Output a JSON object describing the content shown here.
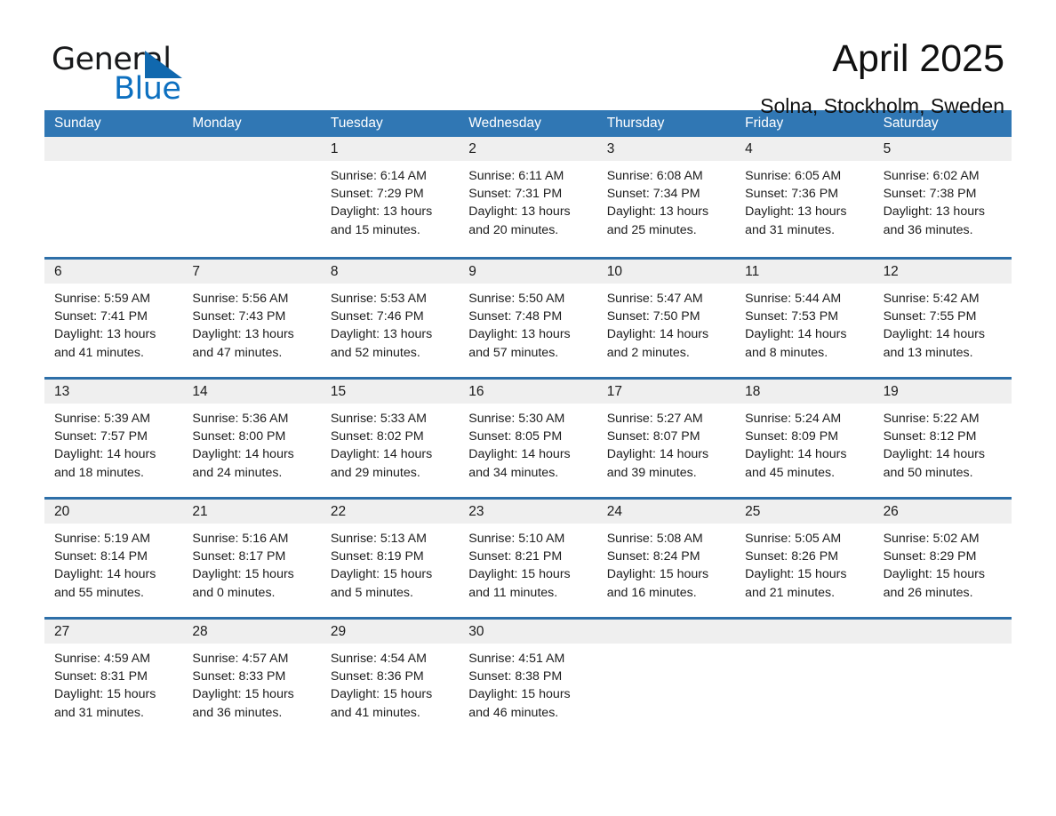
{
  "brand": {
    "name_part1": "General",
    "name_part2": "Blue",
    "accent_color": "#1068ae"
  },
  "header": {
    "title": "April 2025",
    "location": "Solna, Stockholm, Sweden"
  },
  "theme": {
    "header_blue": "#3077b4",
    "separator_blue": "#2e6fa8",
    "daynum_band": "#efefef"
  },
  "weekdays": [
    "Sunday",
    "Monday",
    "Tuesday",
    "Wednesday",
    "Thursday",
    "Friday",
    "Saturday"
  ],
  "weeks": [
    [
      {
        "day": "",
        "sunrise": "",
        "sunset": "",
        "daylight_line1": "",
        "daylight_line2": ""
      },
      {
        "day": "",
        "sunrise": "",
        "sunset": "",
        "daylight_line1": "",
        "daylight_line2": ""
      },
      {
        "day": "1",
        "sunrise": "Sunrise: 6:14 AM",
        "sunset": "Sunset: 7:29 PM",
        "daylight_line1": "Daylight: 13 hours",
        "daylight_line2": "and 15 minutes."
      },
      {
        "day": "2",
        "sunrise": "Sunrise: 6:11 AM",
        "sunset": "Sunset: 7:31 PM",
        "daylight_line1": "Daylight: 13 hours",
        "daylight_line2": "and 20 minutes."
      },
      {
        "day": "3",
        "sunrise": "Sunrise: 6:08 AM",
        "sunset": "Sunset: 7:34 PM",
        "daylight_line1": "Daylight: 13 hours",
        "daylight_line2": "and 25 minutes."
      },
      {
        "day": "4",
        "sunrise": "Sunrise: 6:05 AM",
        "sunset": "Sunset: 7:36 PM",
        "daylight_line1": "Daylight: 13 hours",
        "daylight_line2": "and 31 minutes."
      },
      {
        "day": "5",
        "sunrise": "Sunrise: 6:02 AM",
        "sunset": "Sunset: 7:38 PM",
        "daylight_line1": "Daylight: 13 hours",
        "daylight_line2": "and 36 minutes."
      }
    ],
    [
      {
        "day": "6",
        "sunrise": "Sunrise: 5:59 AM",
        "sunset": "Sunset: 7:41 PM",
        "daylight_line1": "Daylight: 13 hours",
        "daylight_line2": "and 41 minutes."
      },
      {
        "day": "7",
        "sunrise": "Sunrise: 5:56 AM",
        "sunset": "Sunset: 7:43 PM",
        "daylight_line1": "Daylight: 13 hours",
        "daylight_line2": "and 47 minutes."
      },
      {
        "day": "8",
        "sunrise": "Sunrise: 5:53 AM",
        "sunset": "Sunset: 7:46 PM",
        "daylight_line1": "Daylight: 13 hours",
        "daylight_line2": "and 52 minutes."
      },
      {
        "day": "9",
        "sunrise": "Sunrise: 5:50 AM",
        "sunset": "Sunset: 7:48 PM",
        "daylight_line1": "Daylight: 13 hours",
        "daylight_line2": "and 57 minutes."
      },
      {
        "day": "10",
        "sunrise": "Sunrise: 5:47 AM",
        "sunset": "Sunset: 7:50 PM",
        "daylight_line1": "Daylight: 14 hours",
        "daylight_line2": "and 2 minutes."
      },
      {
        "day": "11",
        "sunrise": "Sunrise: 5:44 AM",
        "sunset": "Sunset: 7:53 PM",
        "daylight_line1": "Daylight: 14 hours",
        "daylight_line2": "and 8 minutes."
      },
      {
        "day": "12",
        "sunrise": "Sunrise: 5:42 AM",
        "sunset": "Sunset: 7:55 PM",
        "daylight_line1": "Daylight: 14 hours",
        "daylight_line2": "and 13 minutes."
      }
    ],
    [
      {
        "day": "13",
        "sunrise": "Sunrise: 5:39 AM",
        "sunset": "Sunset: 7:57 PM",
        "daylight_line1": "Daylight: 14 hours",
        "daylight_line2": "and 18 minutes."
      },
      {
        "day": "14",
        "sunrise": "Sunrise: 5:36 AM",
        "sunset": "Sunset: 8:00 PM",
        "daylight_line1": "Daylight: 14 hours",
        "daylight_line2": "and 24 minutes."
      },
      {
        "day": "15",
        "sunrise": "Sunrise: 5:33 AM",
        "sunset": "Sunset: 8:02 PM",
        "daylight_line1": "Daylight: 14 hours",
        "daylight_line2": "and 29 minutes."
      },
      {
        "day": "16",
        "sunrise": "Sunrise: 5:30 AM",
        "sunset": "Sunset: 8:05 PM",
        "daylight_line1": "Daylight: 14 hours",
        "daylight_line2": "and 34 minutes."
      },
      {
        "day": "17",
        "sunrise": "Sunrise: 5:27 AM",
        "sunset": "Sunset: 8:07 PM",
        "daylight_line1": "Daylight: 14 hours",
        "daylight_line2": "and 39 minutes."
      },
      {
        "day": "18",
        "sunrise": "Sunrise: 5:24 AM",
        "sunset": "Sunset: 8:09 PM",
        "daylight_line1": "Daylight: 14 hours",
        "daylight_line2": "and 45 minutes."
      },
      {
        "day": "19",
        "sunrise": "Sunrise: 5:22 AM",
        "sunset": "Sunset: 8:12 PM",
        "daylight_line1": "Daylight: 14 hours",
        "daylight_line2": "and 50 minutes."
      }
    ],
    [
      {
        "day": "20",
        "sunrise": "Sunrise: 5:19 AM",
        "sunset": "Sunset: 8:14 PM",
        "daylight_line1": "Daylight: 14 hours",
        "daylight_line2": "and 55 minutes."
      },
      {
        "day": "21",
        "sunrise": "Sunrise: 5:16 AM",
        "sunset": "Sunset: 8:17 PM",
        "daylight_line1": "Daylight: 15 hours",
        "daylight_line2": "and 0 minutes."
      },
      {
        "day": "22",
        "sunrise": "Sunrise: 5:13 AM",
        "sunset": "Sunset: 8:19 PM",
        "daylight_line1": "Daylight: 15 hours",
        "daylight_line2": "and 5 minutes."
      },
      {
        "day": "23",
        "sunrise": "Sunrise: 5:10 AM",
        "sunset": "Sunset: 8:21 PM",
        "daylight_line1": "Daylight: 15 hours",
        "daylight_line2": "and 11 minutes."
      },
      {
        "day": "24",
        "sunrise": "Sunrise: 5:08 AM",
        "sunset": "Sunset: 8:24 PM",
        "daylight_line1": "Daylight: 15 hours",
        "daylight_line2": "and 16 minutes."
      },
      {
        "day": "25",
        "sunrise": "Sunrise: 5:05 AM",
        "sunset": "Sunset: 8:26 PM",
        "daylight_line1": "Daylight: 15 hours",
        "daylight_line2": "and 21 minutes."
      },
      {
        "day": "26",
        "sunrise": "Sunrise: 5:02 AM",
        "sunset": "Sunset: 8:29 PM",
        "daylight_line1": "Daylight: 15 hours",
        "daylight_line2": "and 26 minutes."
      }
    ],
    [
      {
        "day": "27",
        "sunrise": "Sunrise: 4:59 AM",
        "sunset": "Sunset: 8:31 PM",
        "daylight_line1": "Daylight: 15 hours",
        "daylight_line2": "and 31 minutes."
      },
      {
        "day": "28",
        "sunrise": "Sunrise: 4:57 AM",
        "sunset": "Sunset: 8:33 PM",
        "daylight_line1": "Daylight: 15 hours",
        "daylight_line2": "and 36 minutes."
      },
      {
        "day": "29",
        "sunrise": "Sunrise: 4:54 AM",
        "sunset": "Sunset: 8:36 PM",
        "daylight_line1": "Daylight: 15 hours",
        "daylight_line2": "and 41 minutes."
      },
      {
        "day": "30",
        "sunrise": "Sunrise: 4:51 AM",
        "sunset": "Sunset: 8:38 PM",
        "daylight_line1": "Daylight: 15 hours",
        "daylight_line2": "and 46 minutes."
      },
      {
        "day": "",
        "sunrise": "",
        "sunset": "",
        "daylight_line1": "",
        "daylight_line2": ""
      },
      {
        "day": "",
        "sunrise": "",
        "sunset": "",
        "daylight_line1": "",
        "daylight_line2": ""
      },
      {
        "day": "",
        "sunrise": "",
        "sunset": "",
        "daylight_line1": "",
        "daylight_line2": ""
      }
    ]
  ]
}
